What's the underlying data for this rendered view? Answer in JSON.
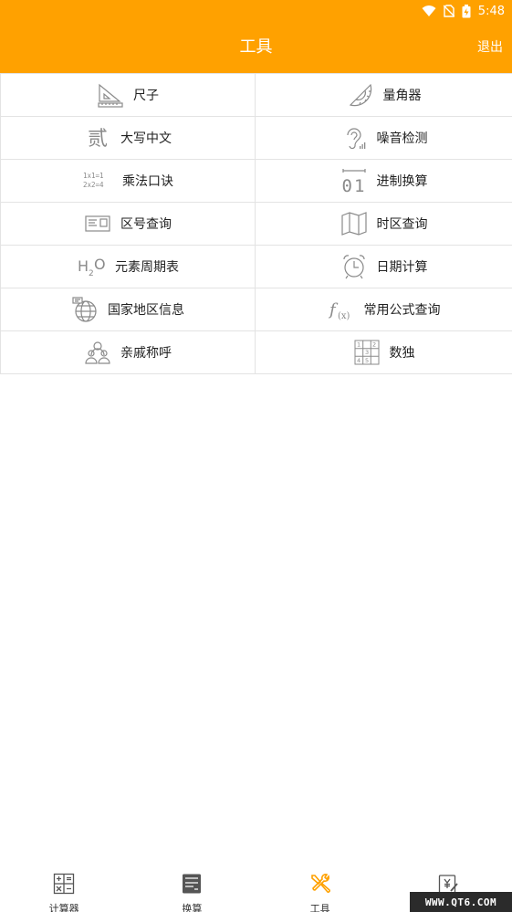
{
  "status": {
    "time": "5:48"
  },
  "header": {
    "title": "工具",
    "exit_label": "退出"
  },
  "tools": [
    {
      "label": "尺子",
      "icon": "ruler-triangle-icon"
    },
    {
      "label": "量角器",
      "icon": "protractor-icon"
    },
    {
      "label": "大写中文",
      "icon": "chinese-numeral-icon"
    },
    {
      "label": "噪音检测",
      "icon": "ear-noise-icon"
    },
    {
      "label": "乘法口诀",
      "icon": "multiplication-table-icon"
    },
    {
      "label": "进制换算",
      "icon": "binary-convert-icon"
    },
    {
      "label": "区号查询",
      "icon": "area-code-card-icon"
    },
    {
      "label": "时区查询",
      "icon": "map-icon"
    },
    {
      "label": "元素周期表",
      "icon": "h2o-icon"
    },
    {
      "label": "日期计算",
      "icon": "alarm-clock-icon"
    },
    {
      "label": "国家地区信息",
      "icon": "globe-flag-icon"
    },
    {
      "label": "常用公式查询",
      "icon": "formula-fx-icon"
    },
    {
      "label": "亲戚称呼",
      "icon": "family-icon"
    },
    {
      "label": "数独",
      "icon": "sudoku-grid-icon"
    }
  ],
  "multiplication_icon_text": [
    "1x1=1",
    "2x2=4"
  ],
  "binary_icon_text": "01",
  "h2o_icon_text": {
    "h": "H",
    "two": "2",
    "o": "O"
  },
  "formula_icon_text": {
    "f": "f",
    "x": "(x)"
  },
  "sudoku_icon_digits": [
    "1",
    "2",
    "3",
    "4",
    "5"
  ],
  "chinese_icon_text": "贰",
  "tabs": [
    {
      "label": "计算器",
      "icon": "calculator-icon",
      "active": false
    },
    {
      "label": "换算",
      "icon": "convert-doc-icon",
      "active": false
    },
    {
      "label": "工具",
      "icon": "tools-icon",
      "active": true
    },
    {
      "label": "",
      "icon": "note-yen-icon",
      "active": false
    }
  ],
  "watermark": "WWW.QT6.COM",
  "colors": {
    "accent": "#ffa100",
    "icon_gray": "#8a8a8a",
    "active_tab": "#ffa100"
  }
}
